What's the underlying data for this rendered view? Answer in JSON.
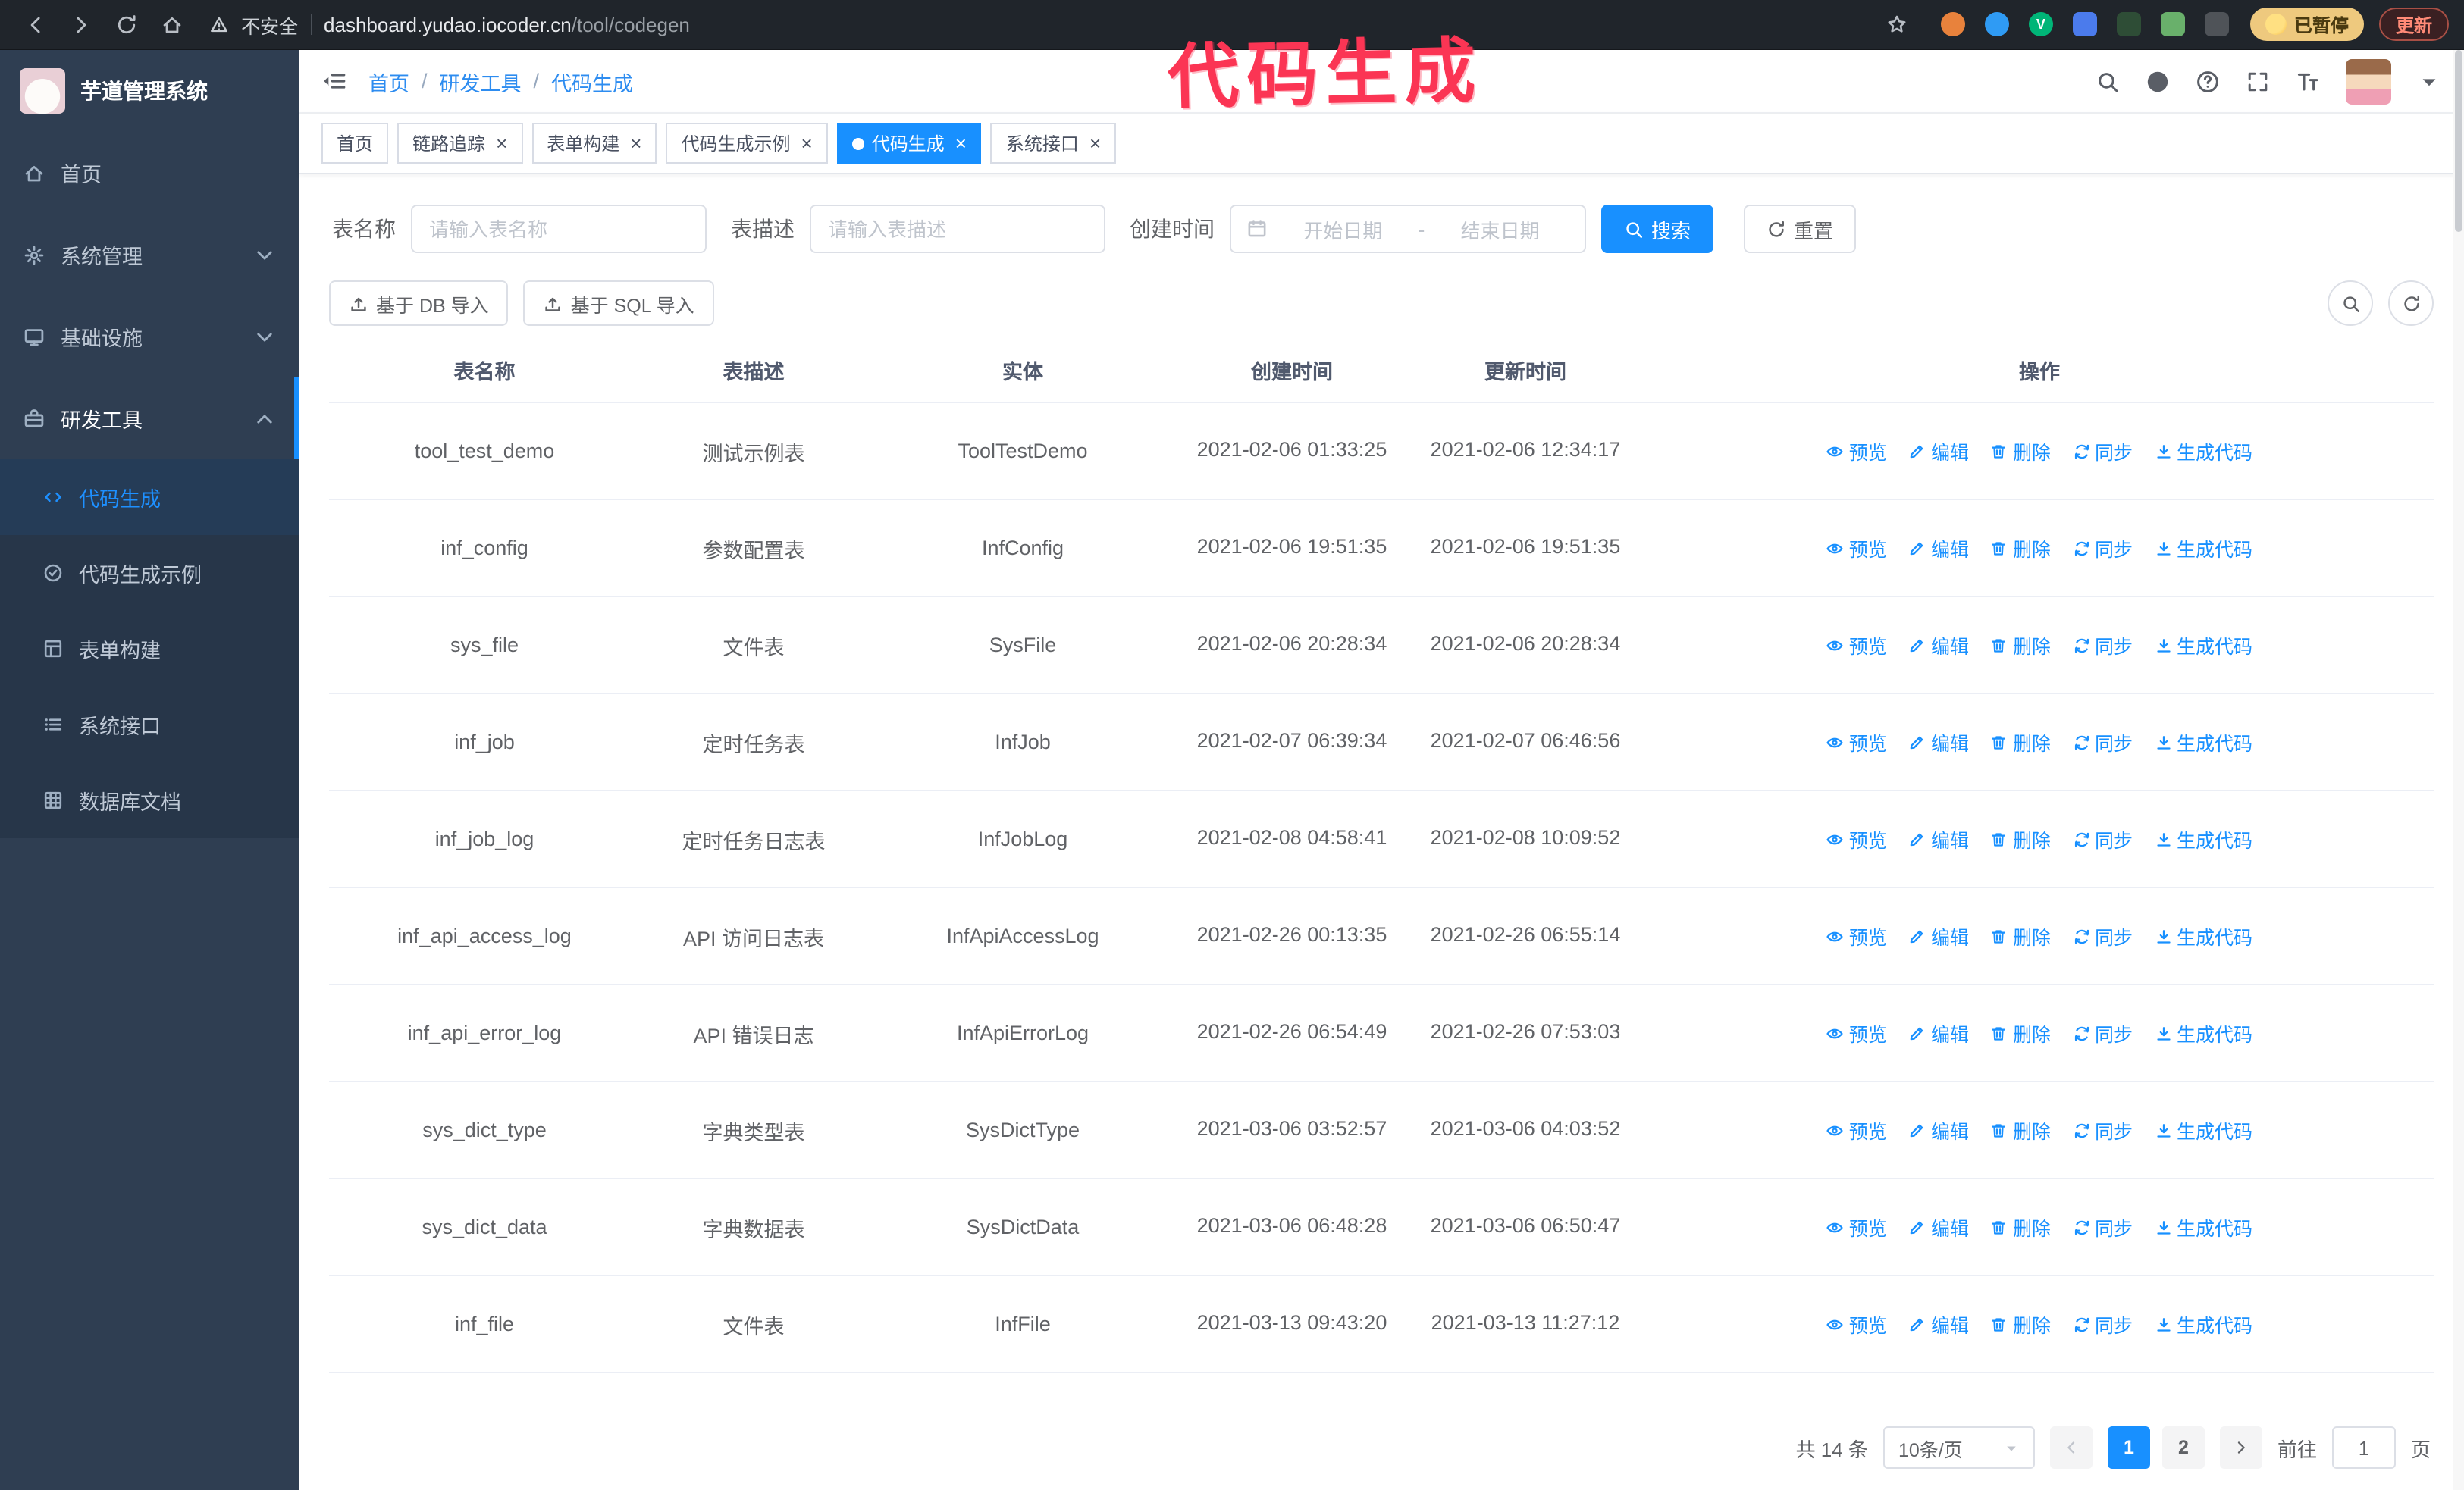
{
  "annotation": "代码生成",
  "colors": {
    "accent": "#1890ff",
    "sidebar_bg": "#2f3e52",
    "annotation": "#fb3554",
    "paused_badge_bg": "#eec97e"
  },
  "browser": {
    "security_label": "不安全",
    "url_host": "dashboard.yudao.iocoder.cn",
    "url_path": "/tool/codegen",
    "paused_badge": "已暂停",
    "update_button": "更新",
    "extensions": [
      {
        "name": "extension-orange",
        "color": "#e8823c",
        "shape": "circle",
        "letter": ""
      },
      {
        "name": "extension-blue-drop",
        "color": "#2f9bf4",
        "shape": "circle",
        "letter": ""
      },
      {
        "name": "extension-green-v",
        "color": "#00b577",
        "shape": "circle",
        "letter": "V"
      },
      {
        "name": "extension-blue-square",
        "color": "#4b7bec",
        "shape": "square",
        "letter": ""
      },
      {
        "name": "extension-dark-green",
        "color": "#2e4d36",
        "shape": "square",
        "letter": ""
      },
      {
        "name": "extension-green",
        "color": "#69b06b",
        "shape": "square",
        "letter": ""
      },
      {
        "name": "extension-dark-puzzle",
        "color": "#4f5358",
        "shape": "square",
        "letter": ""
      }
    ]
  },
  "sidebar": {
    "app_title": "芋道管理系统",
    "items": [
      {
        "key": "home",
        "label": "首页",
        "icon": "home"
      },
      {
        "key": "system",
        "label": "系统管理",
        "icon": "gear",
        "chevron": "down"
      },
      {
        "key": "infra",
        "label": "基础设施",
        "icon": "monitor",
        "chevron": "down"
      },
      {
        "key": "devtools",
        "label": "研发工具",
        "icon": "tool",
        "chevron": "up",
        "expanded": true
      }
    ],
    "subitems": [
      {
        "key": "codegen",
        "label": "代码生成",
        "icon": "code",
        "active": true
      },
      {
        "key": "codegen-example",
        "label": "代码生成示例",
        "icon": "badge"
      },
      {
        "key": "form-builder",
        "label": "表单构建",
        "icon": "form"
      },
      {
        "key": "api",
        "label": "系统接口",
        "icon": "api"
      },
      {
        "key": "db-doc",
        "label": "数据库文档",
        "icon": "grid"
      }
    ]
  },
  "header": {
    "breadcrumb": [
      "首页",
      "研发工具",
      "代码生成"
    ]
  },
  "tabs": [
    {
      "label": "首页",
      "closable": false,
      "active": false
    },
    {
      "label": "链路追踪",
      "closable": true,
      "active": false
    },
    {
      "label": "表单构建",
      "closable": true,
      "active": false
    },
    {
      "label": "代码生成示例",
      "closable": true,
      "active": false
    },
    {
      "label": "代码生成",
      "closable": true,
      "active": true
    },
    {
      "label": "系统接口",
      "closable": true,
      "active": false
    }
  ],
  "filters": {
    "table_name_label": "表名称",
    "table_name_placeholder": "请输入表名称",
    "table_desc_label": "表描述",
    "table_desc_placeholder": "请输入表描述",
    "create_time_label": "创建时间",
    "date_start_placeholder": "开始日期",
    "date_separator": "-",
    "date_end_placeholder": "结束日期",
    "search_button": "搜索",
    "reset_button": "重置"
  },
  "toolbar": {
    "import_db": "基于 DB 导入",
    "import_sql": "基于 SQL 导入"
  },
  "table": {
    "columns": [
      "表名称",
      "表描述",
      "实体",
      "创建时间",
      "更新时间",
      "操作"
    ],
    "actions": [
      "预览",
      "编辑",
      "删除",
      "同步",
      "生成代码"
    ],
    "rows": [
      {
        "name": "tool_test_demo",
        "desc": "测试示例表",
        "entity": "ToolTestDemo",
        "created": "2021-02-06 01:33:25",
        "updated": "2021-02-06 12:34:17"
      },
      {
        "name": "inf_config",
        "desc": "参数配置表",
        "entity": "InfConfig",
        "created": "2021-02-06 19:51:35",
        "updated": "2021-02-06 19:51:35"
      },
      {
        "name": "sys_file",
        "desc": "文件表",
        "entity": "SysFile",
        "created": "2021-02-06 20:28:34",
        "updated": "2021-02-06 20:28:34"
      },
      {
        "name": "inf_job",
        "desc": "定时任务表",
        "entity": "InfJob",
        "created": "2021-02-07 06:39:34",
        "updated": "2021-02-07 06:46:56"
      },
      {
        "name": "inf_job_log",
        "desc": "定时任务日志表",
        "entity": "InfJobLog",
        "created": "2021-02-08 04:58:41",
        "updated": "2021-02-08 10:09:52"
      },
      {
        "name": "inf_api_access_log",
        "desc": "API 访问日志表",
        "entity": "InfApiAccessLog",
        "created": "2021-02-26 00:13:35",
        "updated": "2021-02-26 06:55:14"
      },
      {
        "name": "inf_api_error_log",
        "desc": "API 错误日志",
        "entity": "InfApiErrorLog",
        "created": "2021-02-26 06:54:49",
        "updated": "2021-02-26 07:53:03"
      },
      {
        "name": "sys_dict_type",
        "desc": "字典类型表",
        "entity": "SysDictType",
        "created": "2021-03-06 03:52:57",
        "updated": "2021-03-06 04:03:52"
      },
      {
        "name": "sys_dict_data",
        "desc": "字典数据表",
        "entity": "SysDictData",
        "created": "2021-03-06 06:48:28",
        "updated": "2021-03-06 06:50:47"
      },
      {
        "name": "inf_file",
        "desc": "文件表",
        "entity": "InfFile",
        "created": "2021-03-13 09:43:20",
        "updated": "2021-03-13 11:27:12"
      }
    ]
  },
  "pagination": {
    "total": "共 14 条",
    "page_size": "10条/页",
    "pages": [
      "1",
      "2"
    ],
    "active_page": "1",
    "goto_label": "前往",
    "goto_value": "1",
    "goto_suffix": "页"
  }
}
